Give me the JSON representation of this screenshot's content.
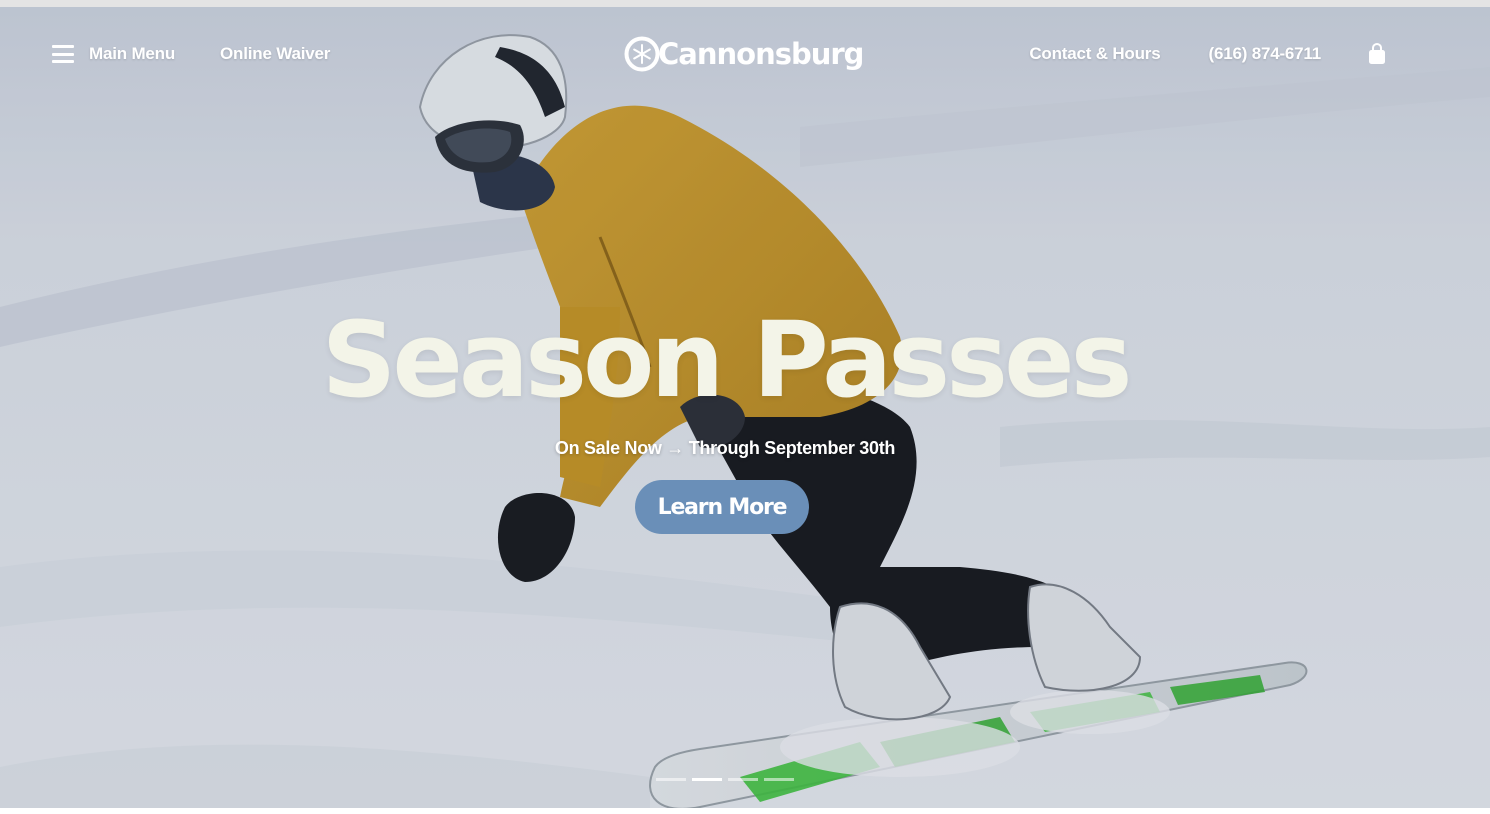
{
  "header": {
    "main_menu_label": "Main Menu",
    "waiver_label": "Online Waiver",
    "logo_text": "Cannonsburg",
    "contact_label": "Contact & Hours",
    "phone_label": "(616) 874-6711"
  },
  "hero": {
    "headline": "Season Passes",
    "subline": "On Sale Now → Through September 30th",
    "cta_label": "Learn More",
    "slides_count": 4,
    "active_slide_index": 1
  },
  "colors": {
    "cta_background": "#6a8fb8",
    "headline": "#f3f4e8",
    "nav_text": "#ffffff"
  },
  "icons": {
    "menu": "hamburger-icon",
    "cart": "shopping-bag-icon",
    "logo": "snowflake-logo-icon"
  }
}
